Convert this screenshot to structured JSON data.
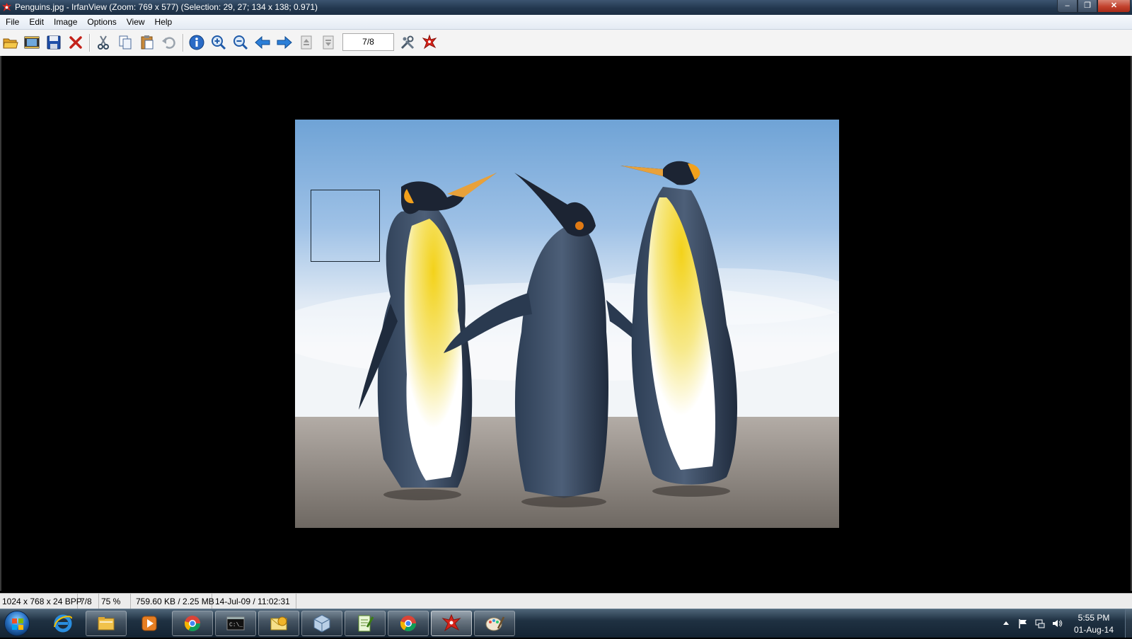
{
  "window": {
    "title": "Penguins.jpg - IrfanView (Zoom: 769 x 577) (Selection: 29, 27; 134 x 138; 0.971)",
    "controls": {
      "minimize": "–",
      "maximize": "❐",
      "close": "✕"
    }
  },
  "menu": [
    "File",
    "Edit",
    "Image",
    "Options",
    "View",
    "Help"
  ],
  "toolbar": {
    "buttons": [
      "open-folder-icon",
      "slideshow-icon",
      "save-icon",
      "delete-icon",
      "cut-icon",
      "copy-icon",
      "paste-icon",
      "undo-icon",
      "info-icon",
      "zoom-in-icon",
      "zoom-out-icon",
      "previous-icon",
      "next-icon",
      "first-page-icon",
      "last-page-icon",
      "settings-icon",
      "irfanview-logo-icon"
    ],
    "page_indicator": "7/8"
  },
  "status": {
    "dimensions": "1024 x 768 x 24 BPP",
    "index": "7/8",
    "zoom": "75 %",
    "size": "759.60 KB / 2.25 MB",
    "date": "14-Jul-09 / 11:02:31"
  },
  "taskbar": {
    "items": [
      "start-button",
      "internet-explorer",
      "windows-explorer",
      "media-player",
      "chrome",
      "command-prompt",
      "outlook",
      "virtualbox",
      "notepad-plus",
      "chrome",
      "irfanview",
      "paint"
    ],
    "clock_time": "5:55 PM",
    "clock_date": "01-Aug-14"
  },
  "colors": {
    "sky": "#7fa9d8",
    "sand": "#8b8580",
    "titlebar": "#23384f"
  }
}
